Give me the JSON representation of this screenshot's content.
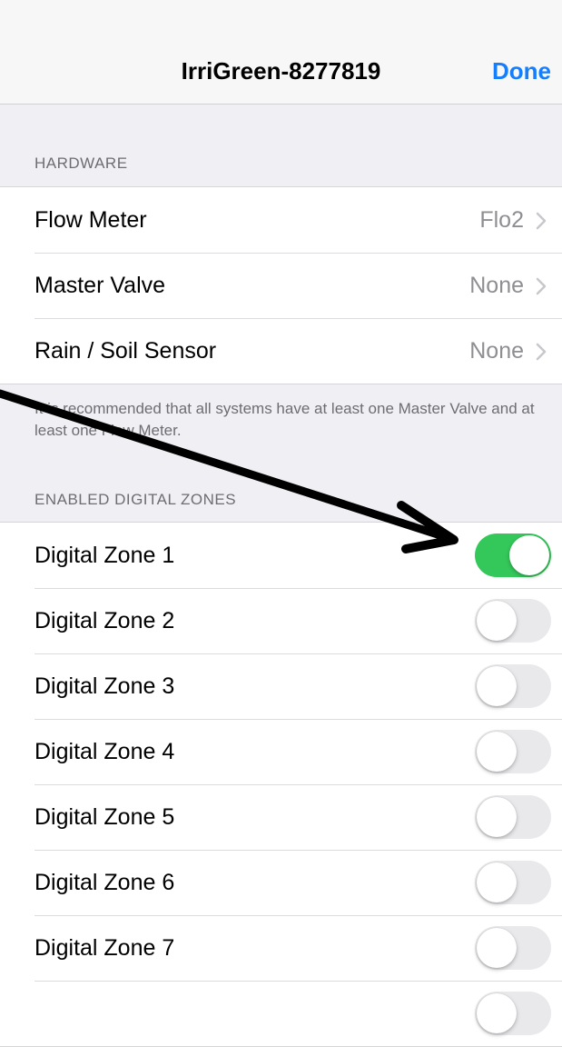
{
  "navbar": {
    "title": "IrriGreen-8277819",
    "done_label": "Done",
    "done_color": "#157efb"
  },
  "hardware": {
    "header": "HARDWARE",
    "items": [
      {
        "label": "Flow Meter",
        "value": "Flo2",
        "icon": "chevron-right-icon"
      },
      {
        "label": "Master Valve",
        "value": "None",
        "icon": "chevron-right-icon"
      },
      {
        "label": "Rain / Soil Sensor",
        "value": "None",
        "icon": "chevron-right-icon"
      }
    ],
    "footer": "It is recommended that all systems have at least one Master Valve and at least one Flow Meter."
  },
  "zones": {
    "header": "ENABLED DIGITAL ZONES",
    "items": [
      {
        "label": "Digital Zone 1",
        "enabled": true
      },
      {
        "label": "Digital Zone 2",
        "enabled": false
      },
      {
        "label": "Digital Zone 3",
        "enabled": false
      },
      {
        "label": "Digital Zone 4",
        "enabled": false
      },
      {
        "label": "Digital Zone 5",
        "enabled": false
      },
      {
        "label": "Digital Zone 6",
        "enabled": false
      },
      {
        "label": "Digital Zone 7",
        "enabled": false
      },
      {
        "label": "",
        "enabled": false
      }
    ],
    "toggle_on_color": "#34c759"
  },
  "annotation": {
    "icon": "arrow-icon",
    "color": "#000000"
  }
}
